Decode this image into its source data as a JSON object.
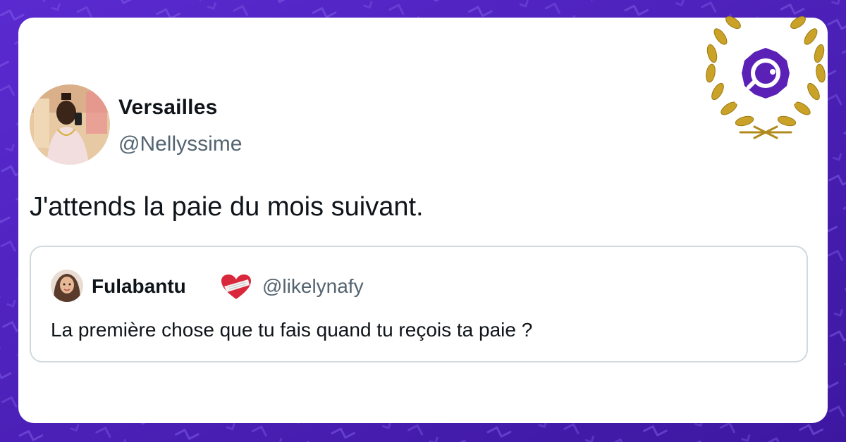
{
  "tweet": {
    "author_name": "Versailles",
    "author_handle": "@Nellyssime",
    "text": "J'attends la paie du mois suivant."
  },
  "quoted_tweet": {
    "author_name": "Fulabantu",
    "author_emoji_icon": "bandaged-heart-icon",
    "author_handle": "@likelynafy",
    "text": "La première chose que tu fais quand tu reçois ta paie ?"
  },
  "badge": {
    "icon": "brand-logo-icon",
    "laurel_color": "#c9a227"
  },
  "colors": {
    "background": "#4a1fb8",
    "card": "#ffffff",
    "text_primary": "#0f1419",
    "text_secondary": "#536471",
    "quote_border": "#cfd9de",
    "brand": "#5b21b6"
  }
}
